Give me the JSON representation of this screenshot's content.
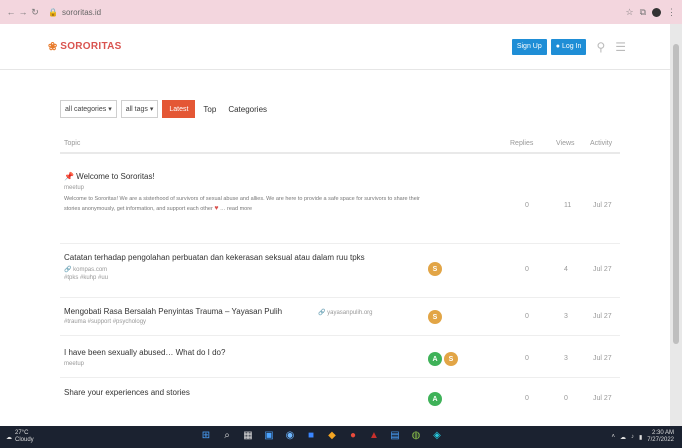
{
  "browser": {
    "url": "sororitas.id",
    "nav_icons": [
      "←",
      "→",
      "↻"
    ],
    "lock_icon": "🔒",
    "right_icons": [
      "☆",
      "⧉",
      "⋮"
    ]
  },
  "site": {
    "logo_mark": "❀",
    "name": "SORORITAS",
    "signup_label": "Sign Up",
    "login_label": "Log In",
    "search_icon": "⚲",
    "menu_icon": "☰"
  },
  "filters": {
    "categories_label": "all categories ▾",
    "tags_label": "all tags ▾",
    "latest_label": "Latest",
    "top_label": "Top",
    "categories_link": "Categories"
  },
  "table": {
    "headers": {
      "topic": "Topic",
      "replies": "Replies",
      "views": "Views",
      "activity": "Activity"
    },
    "rows": [
      {
        "title": "📌 Welcome to Sororitas!",
        "meta": "meetup",
        "excerpt": "Welcome to Sororitas! We are a sisterhood of survivors of sexual abuse and allies. We are here to provide a safe space for survivors to share their stories anonymously, get information, and support each other",
        "heart": "♥",
        "more": "… read more",
        "replies": "0",
        "views": "11",
        "activity": "Jul 27"
      },
      {
        "title": "Catatan terhadap pengolahan perbuatan dan kekerasan seksual atau dalam ruu tpks",
        "meta": "🔗 kompas.com",
        "meta2": "#tpks  #kuhp  #uu",
        "replies": "0",
        "views": "4",
        "activity": "Jul 27",
        "avatars": [
          {
            "letter": "S",
            "color": "#e2a546"
          }
        ]
      },
      {
        "title": "Mengobati Rasa Bersalah Penyintas Trauma – Yayasan Pulih",
        "meta": "#trauma  #support  #psychology",
        "link_tag": "🔗 yayasanpulih.org",
        "replies": "0",
        "views": "3",
        "activity": "Jul 27",
        "avatars": [
          {
            "letter": "S",
            "color": "#e2a546"
          }
        ]
      },
      {
        "title": "I have been sexually abused… What do I do?",
        "meta": "meetup",
        "replies": "0",
        "views": "3",
        "activity": "Jul 27",
        "avatars": [
          {
            "letter": "A",
            "color": "#3fb259"
          },
          {
            "letter": "S",
            "color": "#e2a546"
          }
        ]
      },
      {
        "title": "Share your experiences and stories",
        "meta": "",
        "replies": "0",
        "views": "0",
        "activity": "Jul 27",
        "avatars": [
          {
            "letter": "A",
            "color": "#3fb259"
          }
        ]
      }
    ]
  },
  "taskbar": {
    "temperature": "27°C",
    "weather_desc": "Cloudy",
    "apps": [
      "⊞",
      "⌕",
      "▦",
      "▣",
      "◉",
      "■",
      "◆",
      "●",
      "▲",
      "▤",
      "◍",
      "◈"
    ],
    "time": "2:30 AM",
    "date": "7/27/2022",
    "tray_icons": [
      "˄",
      "☁",
      "♪",
      "▮"
    ]
  }
}
